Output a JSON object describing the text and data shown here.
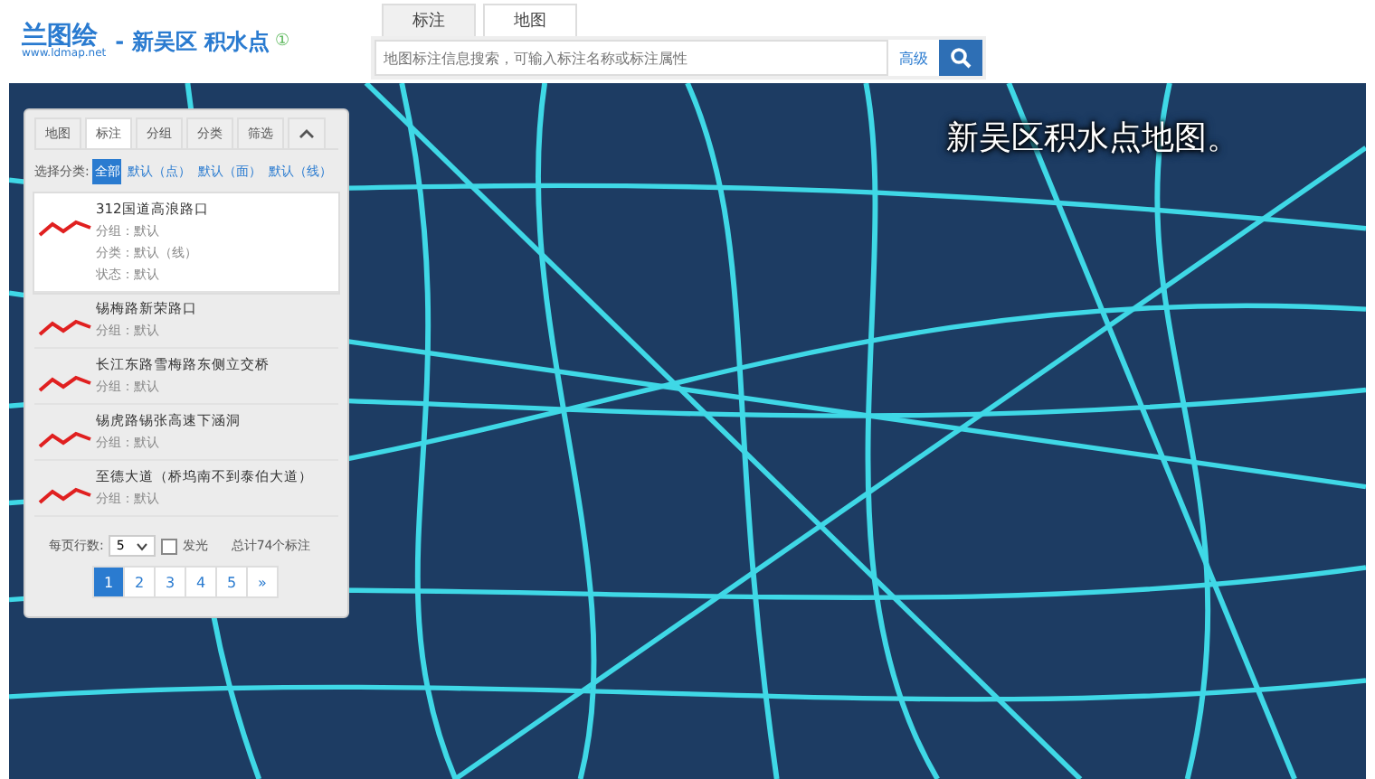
{
  "header": {
    "logo": "兰图绘",
    "logo_url": "www.ldmap.net",
    "title": "- 新吴区 积水点",
    "info_icon": "①"
  },
  "top_tabs": [
    {
      "label": "标注",
      "selected": true
    },
    {
      "label": "地图",
      "selected": false
    }
  ],
  "search": {
    "placeholder": "地图标注信息搜索，可输入标注名称或标注属性",
    "advanced": "高级"
  },
  "map": {
    "caption": "新吴区积水点地图。"
  },
  "panel": {
    "tabs": [
      {
        "label": "地图",
        "selected": false
      },
      {
        "label": "标注",
        "selected": true
      },
      {
        "label": "分组",
        "selected": false
      },
      {
        "label": "分类",
        "selected": false
      },
      {
        "label": "筛选",
        "selected": false
      }
    ],
    "filter_label": "选择分类:",
    "filters": [
      {
        "label": "全部",
        "selected": true
      },
      {
        "label": "默认（点）",
        "selected": false
      },
      {
        "label": "默认（面）",
        "selected": false
      },
      {
        "label": "默认（线）",
        "selected": false
      }
    ],
    "items": [
      {
        "title": "312国道高浪路口",
        "selected": true,
        "details": [
          "分组：默认",
          "分类：默认（线）",
          "状态：默认"
        ]
      },
      {
        "title": "锡梅路新荣路口",
        "selected": false,
        "details": [
          "分组：默认"
        ]
      },
      {
        "title": "长江东路雪梅路东侧立交桥",
        "selected": false,
        "details": [
          "分组：默认"
        ]
      },
      {
        "title": "锡虎路锡张高速下涵洞",
        "selected": false,
        "details": [
          "分组：默认"
        ]
      },
      {
        "title": "至德大道（桥坞南不到泰伯大道）",
        "selected": false,
        "details": [
          "分组：默认"
        ]
      }
    ],
    "rows_label": "每页行数:",
    "rows_value": "5",
    "glow": {
      "label": "发光",
      "checked": false
    },
    "total": "总计74个标注",
    "pages": [
      {
        "label": "1",
        "selected": true
      },
      {
        "label": "2",
        "selected": false
      },
      {
        "label": "3",
        "selected": false
      },
      {
        "label": "4",
        "selected": false
      },
      {
        "label": "5",
        "selected": false
      },
      {
        "label": "»",
        "selected": false
      }
    ]
  }
}
